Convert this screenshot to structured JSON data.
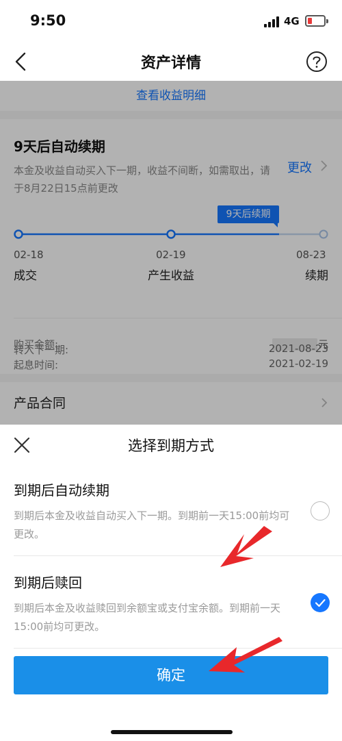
{
  "status_bar": {
    "time": "9:50",
    "network": "4G"
  },
  "nav": {
    "title": "资产详情"
  },
  "background": {
    "link_text": "查看收益明细",
    "card": {
      "title": "9天后自动续期",
      "description": "本金及收益自动买入下一期，收益不间断，如需取出，请于8月22日15点前更改",
      "change_label": "更改",
      "badge": "9天后续期",
      "timeline": [
        {
          "date": "02-18",
          "label": "成交"
        },
        {
          "date": "02-19",
          "label": "产生收益"
        },
        {
          "date": "08-23",
          "label": "续期"
        }
      ],
      "info": [
        {
          "label": "购买金额:",
          "value": "元"
        },
        {
          "label": "起息时间:",
          "value": "2021-02-19"
        },
        {
          "label": "转入下一期:",
          "value": "2021-08-23"
        }
      ]
    },
    "contract_label": "产品合同"
  },
  "sheet": {
    "title": "选择到期方式",
    "options": [
      {
        "title": "到期后自动续期",
        "description": "到期后本金及收益自动买入下一期。到期前一天15:00前均可更改。",
        "selected": false
      },
      {
        "title": "到期后赎回",
        "description": "到期后本金及收益赎回到余额宝或支付宝余额。到期前一天15:00前均可更改。",
        "selected": true
      }
    ],
    "confirm_label": "确定"
  },
  "colors": {
    "accent": "#1677ff",
    "confirm": "#1a8fe8",
    "arrow": "#e8282b"
  },
  "icons": [
    "signal-icon",
    "battery-icon",
    "back-icon",
    "help-icon",
    "chevron-right-icon",
    "close-icon",
    "check-icon"
  ]
}
